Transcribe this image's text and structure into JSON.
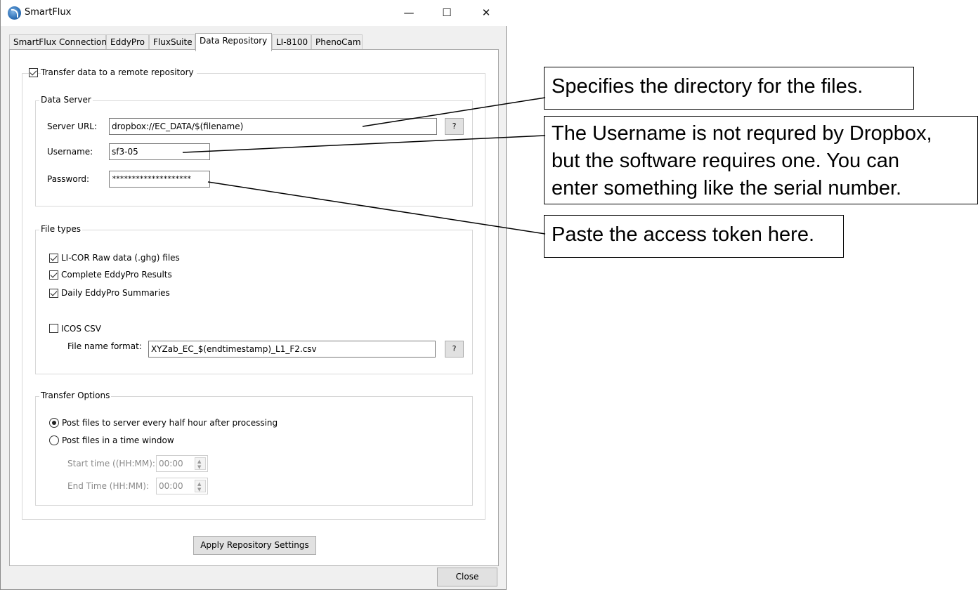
{
  "window": {
    "title": "SmartFlux",
    "controls": {
      "minimize": "—",
      "maximize": "☐",
      "close": "✕"
    }
  },
  "tabs": [
    {
      "label": "SmartFlux Connection",
      "active": false
    },
    {
      "label": "EddyPro",
      "active": false
    },
    {
      "label": "FluxSuite",
      "active": false
    },
    {
      "label": "Data Repository",
      "active": true
    },
    {
      "label": "LI-8100",
      "active": false
    },
    {
      "label": "PhenoCam",
      "active": false
    }
  ],
  "remote": {
    "label": "Transfer data to a remote repository",
    "checked": true
  },
  "data_server": {
    "title": "Data Server",
    "server_url_label": "Server URL:",
    "server_url_value": "dropbox://EC_DATA/$(filename)",
    "help_label": "?",
    "username_label": "Username:",
    "username_value": "sf3-05",
    "password_label": "Password:",
    "password_value": "********************"
  },
  "file_types": {
    "title": "File types",
    "items": [
      {
        "label": "LI-COR Raw data (.ghg) files",
        "checked": true
      },
      {
        "label": "Complete EddyPro Results",
        "checked": true
      },
      {
        "label": "Daily EddyPro Summaries",
        "checked": true
      },
      {
        "label": "ICOS CSV",
        "checked": false
      }
    ],
    "file_name_format_label": "File name format:",
    "file_name_format_value": "XYZab_EC_$(endtimestamp)_L1_F2.csv",
    "help_label": "?"
  },
  "transfer_options": {
    "title": "Transfer Options",
    "options": [
      {
        "label": "Post files to server every half hour after processing",
        "selected": true
      },
      {
        "label": "Post files in a time window",
        "selected": false
      }
    ],
    "start_label": "Start time ((HH:MM):",
    "start_value": "00:00",
    "end_label": "End Time (HH:MM):",
    "end_value": "00:00"
  },
  "buttons": {
    "apply": "Apply Repository Settings",
    "close": "Close"
  },
  "callouts": [
    {
      "lines": [
        "Specifies the directory for the files."
      ]
    },
    {
      "lines": [
        "The Username is not requred by Dropbox,",
        "but the software requires one. You can",
        "enter something like the serial number."
      ]
    },
    {
      "lines": [
        "Paste the access token here."
      ]
    }
  ],
  "colors": {
    "window_bg": "#f0f0f0",
    "panel_bg": "#ffffff",
    "border": "#adadad",
    "disabled_text": "#8a8a8a"
  }
}
